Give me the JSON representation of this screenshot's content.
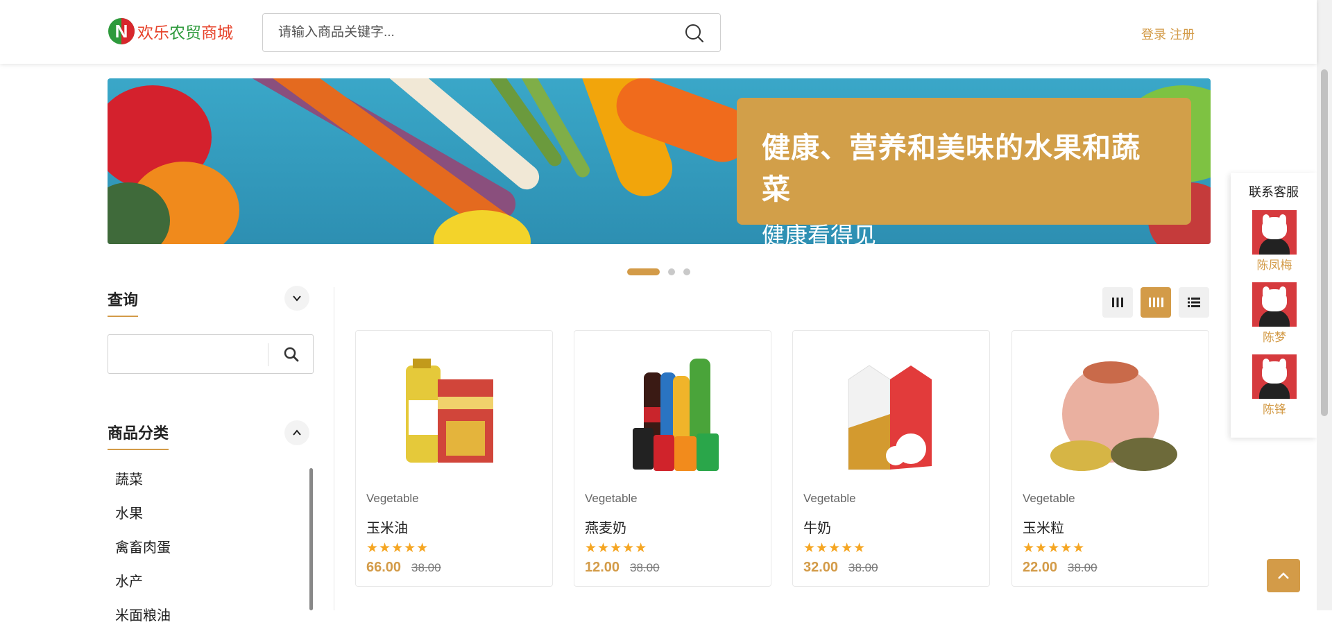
{
  "header": {
    "logo_letter": "N",
    "logo_part1": "欢乐",
    "logo_part2": "农贸",
    "logo_part3": "商城",
    "search_placeholder": "请输入商品关键字...",
    "login": "登录",
    "register": "注册"
  },
  "banner": {
    "title": "健康、营养和美味的水果和蔬菜",
    "subtitle": "健康看得见",
    "slides": 3,
    "active_slide": 1
  },
  "sidebar": {
    "query_title": "查询",
    "category_title": "商品分类",
    "categories": [
      "蔬菜",
      "水果",
      "禽畜肉蛋",
      "水产",
      "米面粮油"
    ]
  },
  "products": [
    {
      "category": "Vegetable",
      "name": "玉米油",
      "price": "66.00",
      "old_price": "38.00",
      "rating": 5
    },
    {
      "category": "Vegetable",
      "name": "燕麦奶",
      "price": "12.00",
      "old_price": "38.00",
      "rating": 5
    },
    {
      "category": "Vegetable",
      "name": "牛奶",
      "price": "32.00",
      "old_price": "38.00",
      "rating": 5
    },
    {
      "category": "Vegetable",
      "name": "玉米粒",
      "price": "22.00",
      "old_price": "38.00",
      "rating": 5
    }
  ],
  "customer_service": {
    "title": "联系客服",
    "agents": [
      "陈凤梅",
      "陈梦",
      "陈锋"
    ]
  },
  "colors": {
    "accent": "#d39b48",
    "logo_green": "#2e9a3c",
    "logo_red": "#e7442c",
    "star": "#f5a623"
  }
}
